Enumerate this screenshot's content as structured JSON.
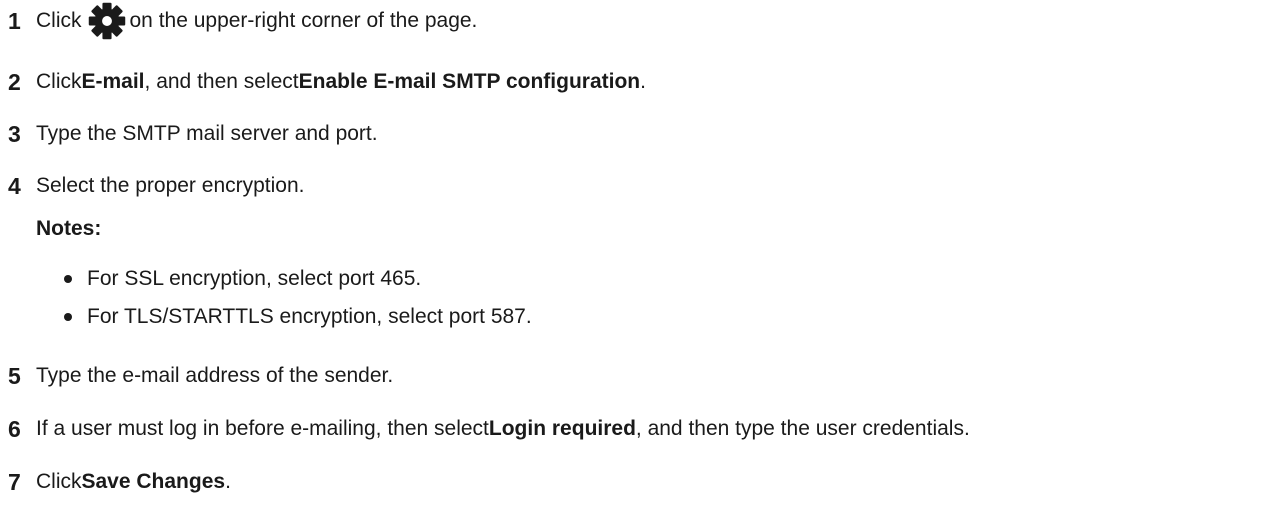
{
  "steps": [
    {
      "num": "1",
      "pre": "Click ",
      "icon": "gear-icon",
      "post": " on the upper-right corner of the page."
    },
    {
      "num": "2",
      "pre": "Click ",
      "b1": "E-mail",
      "mid": ", and then select ",
      "b2": "Enable E-mail SMTP configuration",
      "post": "."
    },
    {
      "num": "3",
      "text": "Type the SMTP mail server and port."
    },
    {
      "num": "4",
      "text": "Select the proper encryption."
    },
    {
      "num": "5",
      "text": "Type the e-mail address of the sender."
    },
    {
      "num": "6",
      "pre": "If a user must log in before e-mailing, then select ",
      "b1": "Login required",
      "post": ", and then type the user credentials."
    },
    {
      "num": "7",
      "pre": "Click ",
      "b1": "Save Changes",
      "post": "."
    }
  ],
  "notes": {
    "title": "Notes:",
    "items": [
      "For SSL encryption, select port 465.",
      "For TLS/STARTTLS encryption, select port 587."
    ]
  }
}
